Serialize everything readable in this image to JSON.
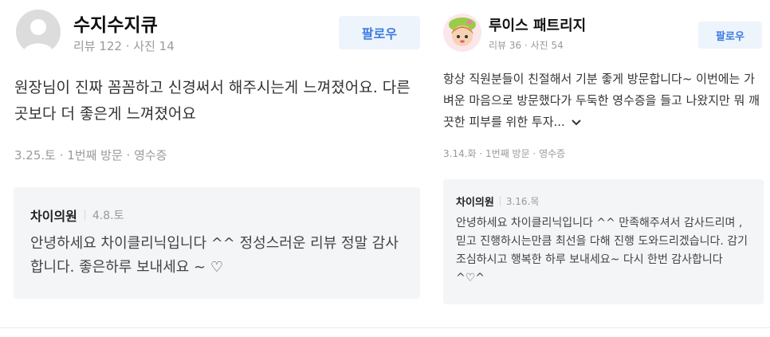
{
  "left": {
    "author": "수지수지큐",
    "stats": "리뷰 122 · 사진 14",
    "follow_label": "팔로우",
    "review_text": "원장님이 진짜 꼼꼼하고 신경써서 해주시는게 느껴졌어요. 다른곳보다 더 좋은게 느껴졌어요",
    "visit_meta": "3.25.토 · 1번째 방문 · 영수증",
    "reply": {
      "name": "차이의원",
      "date": "4.8.토",
      "text": "안녕하세요 차이클리닉입니다 ^^ 정성스러운 리뷰 정말 감사합니다. 좋은하루 보내세요 ~ ♡"
    }
  },
  "right": {
    "author": "루이스 패트리지",
    "stats": "리뷰 36 · 사진 54",
    "follow_label": "팔로우",
    "review_text": "항상 직원분들이 친절해서 기분 좋게 방문합니다~ 이번에는 가벼운 마음으로 방문했다가 두둑한 영수증을 들고 나왔지만 뭐 깨끗한 피부를 위한 투자...",
    "expand_icon": "chevron-down-icon",
    "visit_meta": "3.14.화 · 1번째 방문 · 영수증",
    "reply": {
      "name": "차이의원",
      "date": "3.16.목",
      "text": "안녕하세요 차이클리닉입니다 ^^ 만족해주셔서 감사드리며 , 믿고 진행하시는만큼 최선을 다해 진행 도와드리겠습니다. 감기 조심하시고 행복한 하루 보내세요~ 다시 한번 감사합니다 ^♡^"
    }
  },
  "colors": {
    "follow_bg": "#eef4fb",
    "follow_text": "#3b7be3",
    "reply_bg": "#f3f5f6"
  }
}
